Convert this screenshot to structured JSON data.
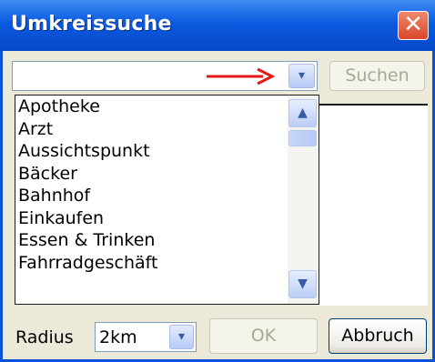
{
  "window": {
    "title": "Umkreissuche",
    "close_glyph": "✕"
  },
  "search": {
    "value": "",
    "button_label": "Suchen",
    "dropdown_glyph": "▾"
  },
  "list": {
    "items": [
      "Apotheke",
      "Arzt",
      "Aussichtspunkt",
      "Bäcker",
      "Bahnhof",
      "Einkaufen",
      "Essen & Trinken",
      "Fahrradgeschäft"
    ],
    "scroll_up_glyph": "▲",
    "scroll_down_glyph": "▼"
  },
  "footer": {
    "radius_label": "Radius",
    "radius_value": "2km",
    "ok_label": "OK",
    "cancel_label": "Abbruch"
  },
  "colors": {
    "title_bar": "#0a5ae0",
    "annotation_arrow": "#e21a1a",
    "close_button": "#d9462a"
  }
}
